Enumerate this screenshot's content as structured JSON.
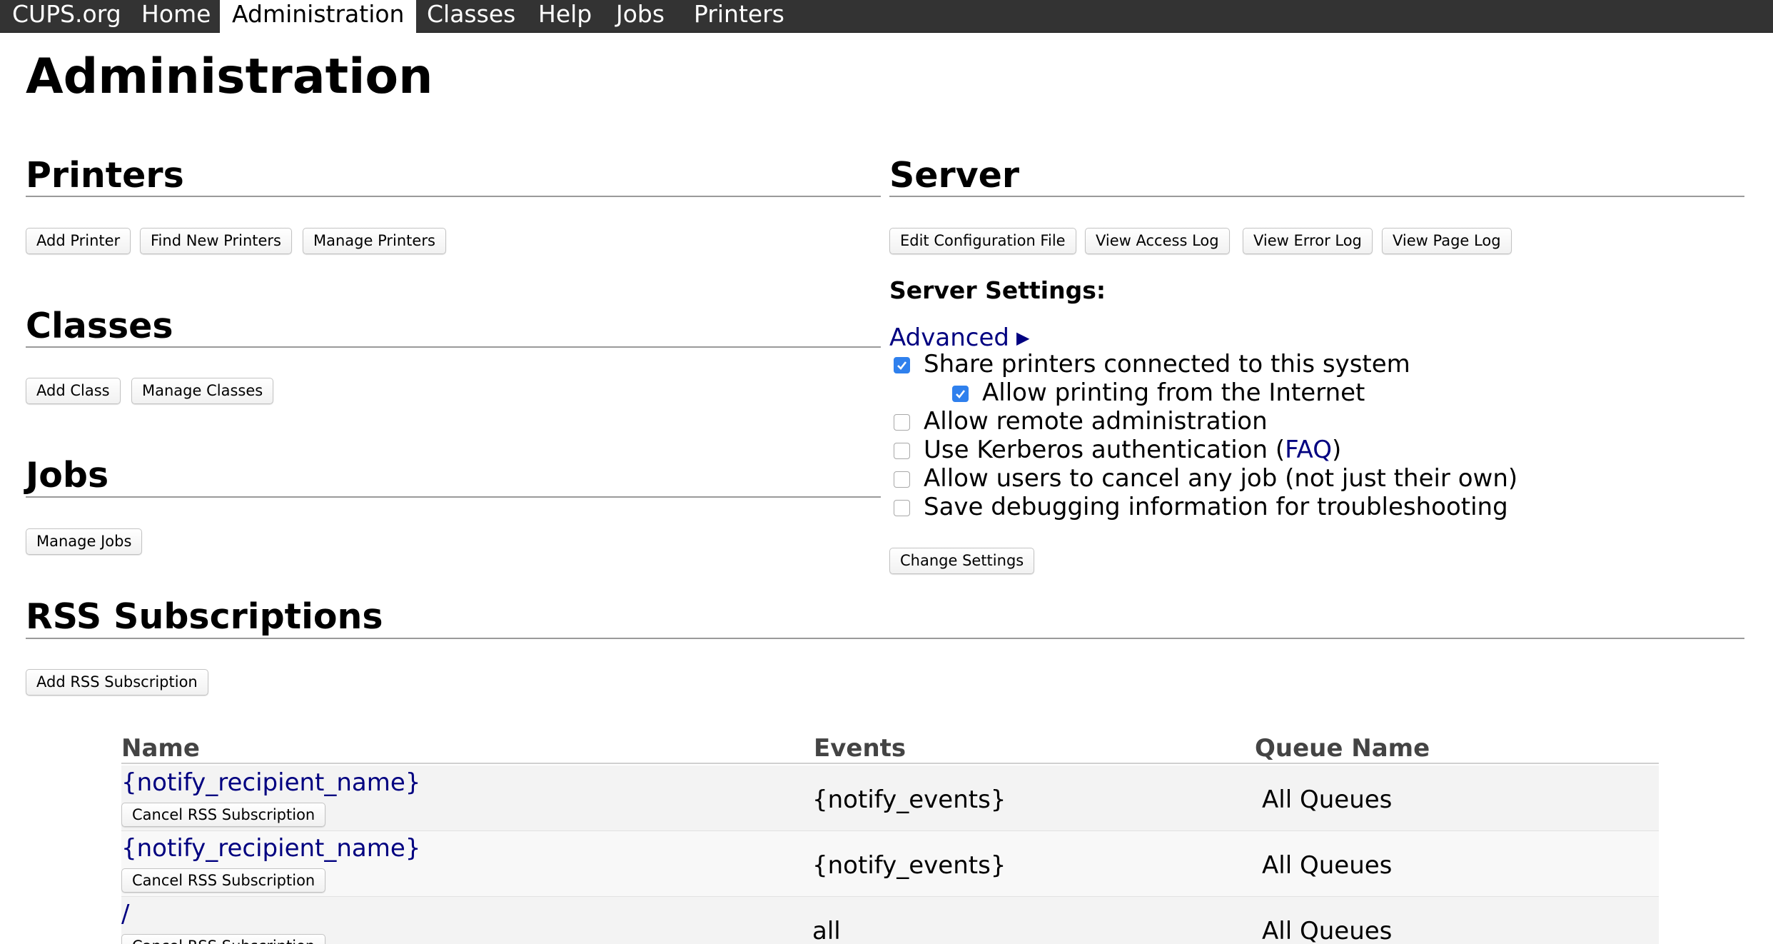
{
  "nav": {
    "items": [
      {
        "label": "CUPS.org",
        "active": false
      },
      {
        "label": "Home",
        "active": false
      },
      {
        "label": "Administration",
        "active": true
      },
      {
        "label": "Classes",
        "active": false
      },
      {
        "label": "Help",
        "active": false
      },
      {
        "label": "Jobs",
        "active": false
      },
      {
        "label": "Printers",
        "active": false
      }
    ]
  },
  "page": {
    "title": "Administration"
  },
  "printers": {
    "title": "Printers",
    "buttons": [
      "Add Printer",
      "Find New Printers",
      "Manage Printers"
    ]
  },
  "classes": {
    "title": "Classes",
    "buttons": [
      "Add Class",
      "Manage Classes"
    ]
  },
  "jobs": {
    "title": "Jobs",
    "buttons": [
      "Manage Jobs"
    ]
  },
  "server": {
    "title": "Server",
    "buttons": [
      "Edit Configuration File",
      "View Access Log",
      "View Error Log",
      "View Page Log"
    ],
    "settings_heading": "Server Settings:",
    "advanced_label": "Advanced",
    "advanced_arrow": "▶",
    "options": [
      {
        "label": "Share printers connected to this system",
        "checked": true
      },
      {
        "label": "Allow printing from the Internet",
        "checked": true
      },
      {
        "label": "Allow remote administration",
        "checked": false
      },
      {
        "label_before": "Use Kerberos authentication (",
        "link": "FAQ",
        "label_after": ")",
        "checked": false
      },
      {
        "label": "Allow users to cancel any job (not just their own)",
        "checked": false
      },
      {
        "label": "Save debugging information for troubleshooting",
        "checked": false
      }
    ],
    "change_settings_label": "Change Settings"
  },
  "rss": {
    "title": "RSS Subscriptions",
    "add_label": "Add RSS Subscription",
    "columns": [
      "Name",
      "Events",
      "Queue Name"
    ],
    "cancel_label": "Cancel RSS Subscription",
    "rows": [
      {
        "name": "{notify_recipient_name}",
        "events": "{notify_events}",
        "queue": "All Queues"
      },
      {
        "name": "{notify_recipient_name}",
        "events": "{notify_events}",
        "queue": "All Queues"
      },
      {
        "name": "/",
        "events": "all",
        "queue": "All Queues"
      }
    ]
  },
  "colors": {
    "navbar_bg": "#333333",
    "link": "#000080",
    "checkbox_checked": "#2f80ed"
  }
}
